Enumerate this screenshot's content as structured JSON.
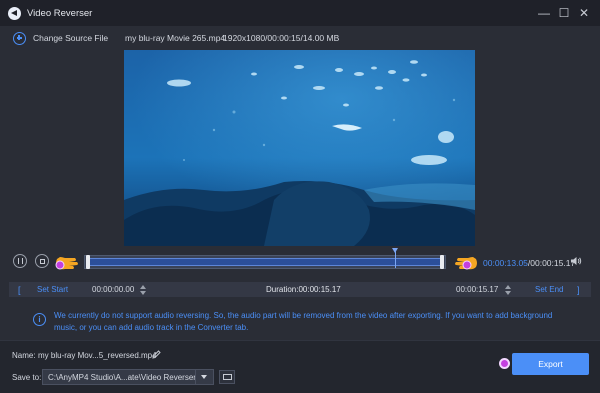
{
  "window": {
    "title": "Video Reverser",
    "controls": {
      "minimize": "—",
      "maximize": "☐",
      "close": "✕"
    }
  },
  "file_bar": {
    "change_source_label": "Change Source File",
    "file_name": "my blu-ray Movie 265.mp4",
    "file_meta": "1920x1080/00:00:15/14.00 MB"
  },
  "player": {
    "current_time": "00:00:13.05",
    "total_time": "/00:00:15.17",
    "playhead_fraction": 0.86
  },
  "set_bar": {
    "left_bracket": "[",
    "set_start_label": "Set Start",
    "start_time": "00:00:00.00",
    "duration_text": "Duration:00:00:15.17",
    "end_time": "00:00:15.17",
    "set_end_label": "Set End",
    "right_bracket": "]"
  },
  "notice": {
    "icon": "i",
    "text": "We currently do not support audio reversing. So, the audio part will be removed from the video after exporting. If you want to add background music, or you can add audio track in the Converter tab."
  },
  "output": {
    "name_label": "Name:",
    "name_value": "my blu-ray Mov...5_reversed.mp4",
    "save_to_label": "Save to:",
    "save_to_value": "C:\\AnyMP4 Studio\\A...ate\\Video Reverser",
    "export_label": "Export"
  },
  "colors": {
    "accent": "#4b8ff7",
    "background": "#2a2d36",
    "titlebar": "#1f2129",
    "badge": "#c43fe0",
    "pointer_hand": "#f5a623"
  },
  "icons": [
    "app-reverse-icon",
    "plus-circle-icon",
    "pause-icon",
    "stop-icon",
    "pointer-hand-icon",
    "volume-icon",
    "info-icon",
    "pencil-icon",
    "folder-icon",
    "chevron-down-icon"
  ]
}
